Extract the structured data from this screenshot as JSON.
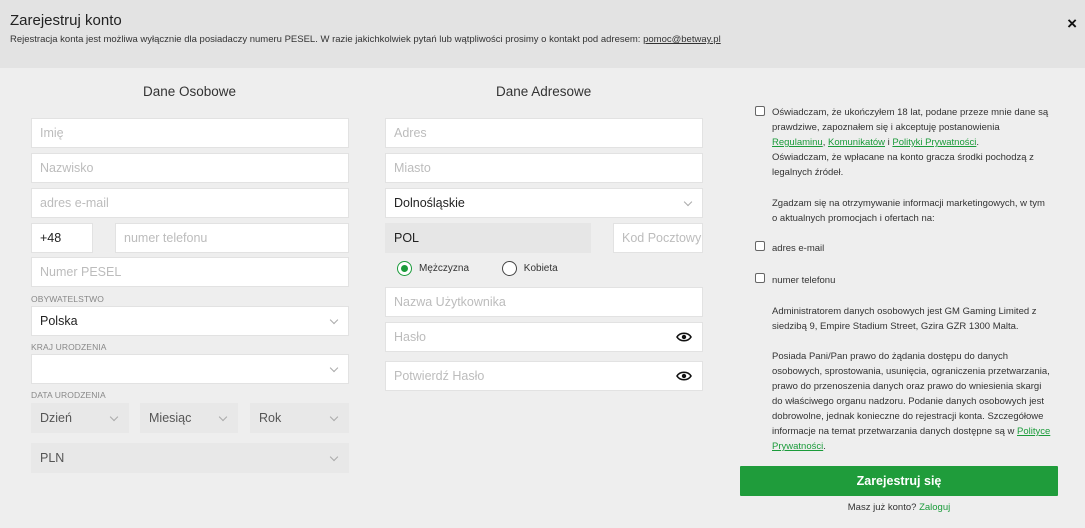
{
  "header": {
    "title": "Zarejestruj konto",
    "subtitle": "Rejestracja konta jest możliwa wyłącznie dla posiadaczy numeru PESEL. W razie jakichkolwiek pytań lub wątpliwości prosimy o kontakt pod adresem: ",
    "email": "pomoc@betway.pl",
    "close": "×"
  },
  "personal": {
    "heading": "Dane Osobowe",
    "first_name_placeholder": "Imię",
    "last_name_placeholder": "Nazwisko",
    "email_placeholder": "adres e-mail",
    "phone_prefix": "+48",
    "phone_placeholder": "numer telefonu",
    "pesel_placeholder": "Numer PESEL",
    "citizenship_label": "OBYWATELSTWO",
    "citizenship_value": "Polska",
    "birth_country_label": "KRAJ URODZENIA",
    "birth_country_value": "",
    "dob_label": "DATA URODZENIA",
    "dob_day": "Dzień",
    "dob_month": "Miesiąc",
    "dob_year": "Rok",
    "currency": "PLN"
  },
  "address": {
    "heading": "Dane Adresowe",
    "address_placeholder": "Adres",
    "city_placeholder": "Miasto",
    "region_value": "Dolnośląskie",
    "country_value": "POL",
    "postal_placeholder": "Kod Pocztowy",
    "gender_male": "Mężczyzna",
    "gender_female": "Kobieta",
    "gender_selected": "Mężczyzna",
    "username_placeholder": "Nazwa Użytkownika",
    "password_placeholder": "Hasło",
    "confirm_password_placeholder": "Potwierdź Hasło"
  },
  "consent": {
    "age_text_1": "Oświadczam, że ukończyłem 18 lat, podane przeze mnie dane są prawdziwe, zapoznałem się i akceptuję postanowienia",
    "link_regulamin": "Regulaminu",
    "sep_1": ", ",
    "link_komunikaty": "Komunikatów",
    "sep_2": " i ",
    "link_polityka": "Polityki Prywatności",
    "age_text_2": ".",
    "age_text_3": "Oświadczam, że wpłacane na konto gracza środki pochodzą z legalnych źródeł.",
    "marketing_text": "Zgadzam się na otrzymywanie informacji marketingowych, w tym o aktualnych promocjach i ofertach na:",
    "marketing_email": "adres e-mail",
    "marketing_phone": "numer telefonu",
    "admin_text": "Administratorem danych osobowych jest GM Gaming Limited z siedzibą 9, Empire Stadium Street, Gzira GZR 1300 Malta.",
    "rights_text": "Posiada Pani/Pan prawo do żądania dostępu do danych osobowych, sprostowania, usunięcia, ograniczenia przetwarzania, prawo do przenoszenia danych oraz prawo do wniesienia skargi do właściwego organu nadzoru. Podanie danych osobowych jest dobrowolne, jednak konieczne do rejestracji konta. Szczegółowe informacje na temat przetwarzania danych dostępne są w ",
    "rights_link": "Polityce Prywatności",
    "rights_end": "."
  },
  "actions": {
    "register": "Zarejestruj się",
    "have_account": "Masz już konto? ",
    "login": "Zaloguj"
  },
  "colors": {
    "accent": "#1f9c3b",
    "header_bg": "#e3e3e3",
    "body_bg": "#eeeeee"
  }
}
